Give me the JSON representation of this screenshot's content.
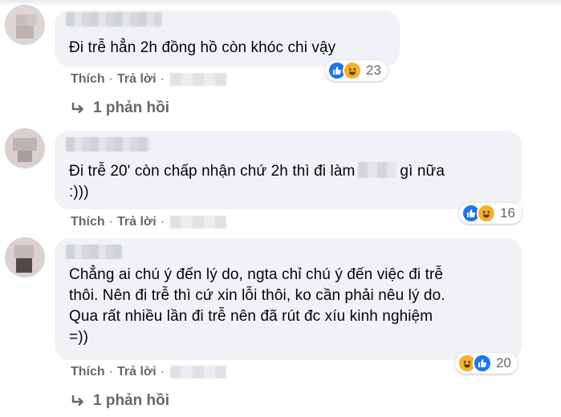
{
  "comments": [
    {
      "text_before": "Đi trễ hẳn 2h đồng hồ còn khóc chi vậy",
      "text_after": "",
      "reaction_count": "23",
      "like_label": "Thích",
      "reply_label": "Trả lời",
      "replies_label": "1 phản hồi"
    },
    {
      "text_before": "Đi trễ 20' còn chấp nhận chứ 2h thì đi làm",
      "text_after": "gì nữa\n:)))",
      "reaction_count": "16",
      "like_label": "Thích",
      "reply_label": "Trả lời",
      "replies_label": ""
    },
    {
      "text_before": "Chẳng ai chú ý đến lý do, ngta chỉ chú ý đến việc đi trễ\nthôi. Nên đi trễ thì cứ xin lỗi thôi, ko cần phải nêu lý do.\nQua rất nhiều lần đi trễ nên đã rút đc xíu kinh nghiệm\n=))",
      "text_after": "",
      "reaction_count": "20",
      "like_label": "Thích",
      "reply_label": "Trả lời",
      "replies_label": "1 phản hồi"
    }
  ],
  "icons": {
    "like": "like-icon",
    "haha": "haha-icon",
    "reply_arrow": "reply-arrow-icon"
  },
  "colors": {
    "bubble": "#f0f2f5",
    "meta": "#65676b",
    "like_blue": "#1877f2",
    "haha_yellow": "#f7b125"
  }
}
